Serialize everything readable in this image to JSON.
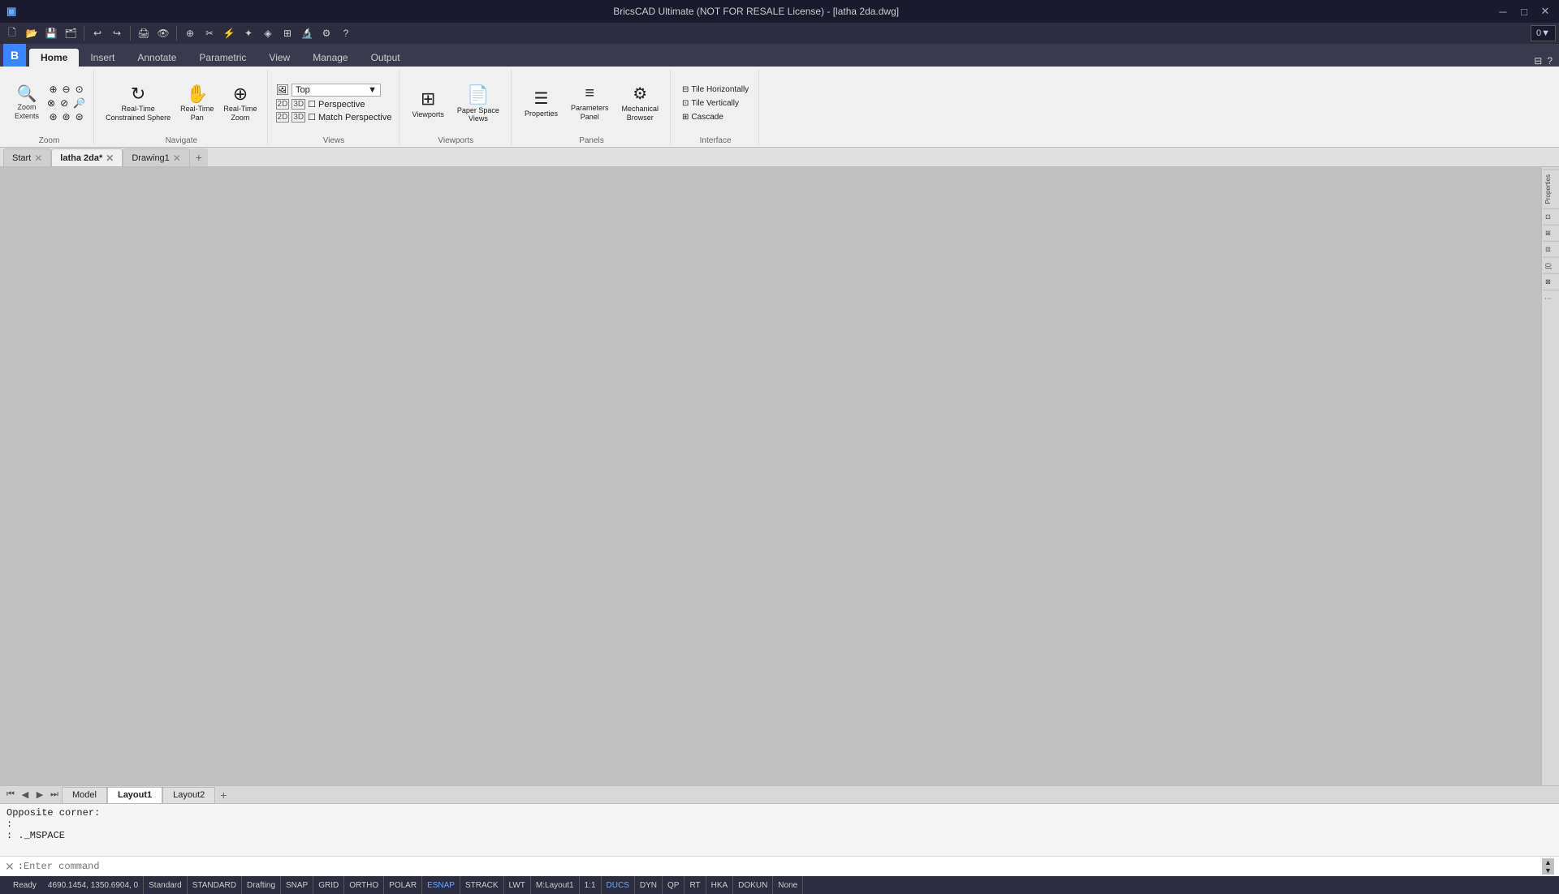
{
  "titleBar": {
    "title": "BricsCAD Ultimate (NOT FOR RESALE License) - [latha 2da.dwg]",
    "minimize": "─",
    "maximize": "□",
    "close": "✕"
  },
  "quickAccess": {
    "buttons": [
      "🗋",
      "📂",
      "💾",
      "↩",
      "↪",
      "✂",
      "📋",
      "🖨"
    ],
    "dropdown": "0"
  },
  "ribbonTabs": {
    "app": "B",
    "tabs": [
      "Home",
      "Insert",
      "Annotate",
      "Parametric",
      "View",
      "Manage",
      "Output"
    ]
  },
  "ribbon": {
    "groups": {
      "zoom": {
        "label": "Zoom",
        "zoomExtents": "Zoom\nExtents",
        "smallBtns": [
          "⊕",
          "⊖",
          "⊙",
          "⊘",
          "🔍",
          "🔎",
          "⊛",
          "⊗"
        ]
      },
      "navigate": {
        "label": "Navigate",
        "buttons": [
          {
            "icon": "↺",
            "label": "Real-Time\nConstrained Sphere"
          },
          {
            "icon": "✥",
            "label": "Real-Time\nPan"
          },
          {
            "icon": "⊕",
            "label": "Real-Time\nZoom"
          }
        ]
      },
      "views": {
        "label": "Views",
        "dropdown": "Top",
        "row1": [
          "2D",
          "3D",
          "Perspective"
        ],
        "row2": [
          "2D",
          "3D",
          "Match Perspective"
        ],
        "checkboxes": [
          false,
          false,
          false,
          false
        ]
      },
      "viewports": {
        "label": "Viewports",
        "buttons": [
          {
            "icon": "⊞",
            "label": "Viewports"
          },
          {
            "icon": "📄",
            "label": "Paper Space\nViews"
          }
        ]
      },
      "panels": {
        "label": "Panels",
        "buttons": [
          {
            "icon": "☰",
            "label": "Properties"
          },
          {
            "icon": "≡",
            "label": "Parameters\nPanel"
          },
          {
            "icon": "⚙",
            "label": "Mechanical\nBrowser"
          }
        ]
      },
      "interface": {
        "label": "Interface",
        "buttons": [
          "Tile Horizontally",
          "Tile Vertically",
          "Cascade"
        ]
      }
    }
  },
  "docTabs": [
    "Start",
    "latha 2da*",
    "Drawing1"
  ],
  "drawing": {
    "hasContent": true
  },
  "layoutTabs": [
    "Model",
    "Layout1",
    "Layout2"
  ],
  "commandArea": {
    "lines": [
      "Opposite corner:",
      ":",
      ": ._MSPACE",
      ""
    ],
    "prompt": ": Enter command"
  },
  "statusBar": {
    "ready": "Ready",
    "coords": "4690.1454, 1350.6904, 0",
    "items": [
      "Standard",
      "STANDARD",
      "Drafting",
      "SNAP",
      "GRID",
      "ORTHO",
      "POLAR",
      "ESNAP",
      "STRACK",
      "LWT",
      "M:Layout1",
      "1:1",
      "DUCS",
      "DYN",
      "QP",
      "RT",
      "HKA",
      "DOKUN",
      "None"
    ]
  },
  "rightPanel": {
    "tabs": [
      "≡",
      "◈",
      "⊞",
      "⊡",
      "⊟",
      "∫"
    ]
  },
  "farRightTabs": [
    "PropertiesPanel",
    "ConstraintsPanel",
    "LayersPanel",
    "BlocksPanel",
    "AttributesPanel"
  ]
}
